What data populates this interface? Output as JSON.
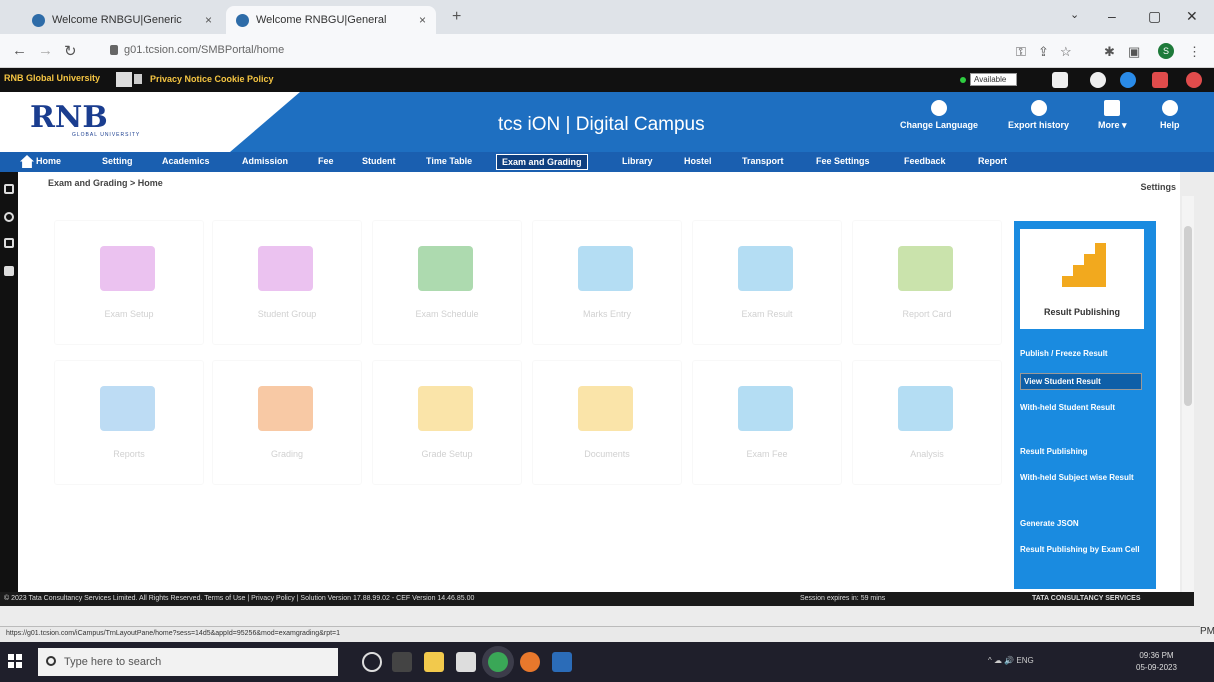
{
  "browser": {
    "tabs": [
      {
        "title": "Welcome RNBGU|Generic"
      },
      {
        "title": "Welcome RNBGU|General"
      }
    ],
    "url": "g01.tcsion.com/SMBPortal/home"
  },
  "topbar": {
    "university": "RNB Global University",
    "privacy": "Privacy Notice  Cookie Policy",
    "status": "Available"
  },
  "banner": {
    "logo": "RNB",
    "logo_sub": "GLOBAL UNIVERSITY",
    "brand": "tcs iON | Digital Campus",
    "items": [
      {
        "label": "Change Language"
      },
      {
        "label": "Export history"
      },
      {
        "label": "More ▾"
      },
      {
        "label": "Help"
      }
    ]
  },
  "nav": {
    "items": [
      {
        "label": "Home"
      },
      {
        "label": "Setting"
      },
      {
        "label": "Academics"
      },
      {
        "label": "Admission"
      },
      {
        "label": "Fee"
      },
      {
        "label": "Student"
      },
      {
        "label": "Time Table"
      },
      {
        "label": "Exam and Grading"
      },
      {
        "label": "Library"
      },
      {
        "label": "Hostel"
      },
      {
        "label": "Transport"
      },
      {
        "label": "Fee Settings"
      },
      {
        "label": "Feedback"
      },
      {
        "label": "Report"
      }
    ]
  },
  "breadcrumb": "Exam and Grading > Home",
  "settings_label": "Settings",
  "tiles": [
    {
      "label": "Exam Setup",
      "color": "#d57ae0"
    },
    {
      "label": "Student Group",
      "color": "#d57ae0"
    },
    {
      "label": "Exam Schedule",
      "color": "#4caf50"
    },
    {
      "label": "Marks Entry",
      "color": "#5ab4e6"
    },
    {
      "label": "Exam Result",
      "color": "#5ab4e6"
    },
    {
      "label": "Report Card",
      "color": "#8bc34a"
    },
    {
      "label": "Reports",
      "color": "#6fb3e8"
    },
    {
      "label": "Grading",
      "color": "#f08a3a"
    },
    {
      "label": "Grade Setup",
      "color": "#f5c542"
    },
    {
      "label": "Documents",
      "color": "#f5c542"
    },
    {
      "label": "Exam Fee",
      "color": "#5ab4e6"
    },
    {
      "label": "Analysis",
      "color": "#5ab4e6"
    }
  ],
  "panel": {
    "title": "Result Publishing",
    "links": [
      {
        "label": "Publish / Freeze Result"
      },
      {
        "label": "View Student Result"
      },
      {
        "label": "With-held Student Result"
      },
      {
        "label": "Result Publishing"
      },
      {
        "label": "With-held Subject wise Result"
      },
      {
        "label": "Generate JSON"
      },
      {
        "label": "Result Publishing by Exam Cell"
      }
    ]
  },
  "footer": {
    "copyright": "© 2023 Tata Consultancy Services Limited. All Rights Reserved.   Terms of Use | Privacy Policy | Solution Version 17.88.99.02 - CEF Version 14.46.85.00",
    "session": "Session expires in: 59 mins",
    "tcs": "TATA CONSULTANCY SERVICES"
  },
  "status_url": "https://g01.tcsion.com/iCampus/TrnLayoutPane/home?sess=14d5&appId=95256&mod=examgrading&rpt=1",
  "taskbar": {
    "search_placeholder": "Type here to search",
    "tray": "ENG",
    "time": "09:36 PM",
    "date": "05-09-2023"
  }
}
